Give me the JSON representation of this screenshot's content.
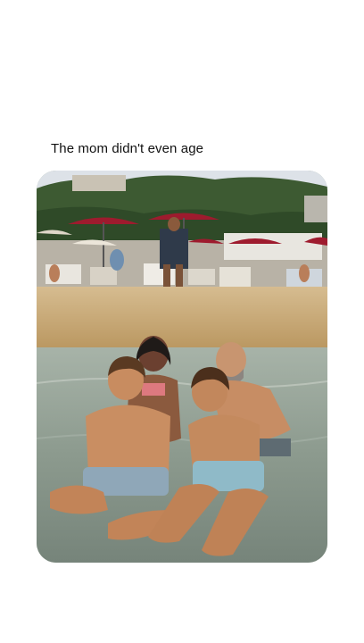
{
  "post": {
    "caption": "The mom didn't even age"
  },
  "photo": {
    "subject": "beach-group-photo",
    "colors": {
      "sky": "#d9dfe6",
      "hill": "#3f5a33",
      "umbrella": "#9e1b2e",
      "sand": "#c9ab7c",
      "water": "#8f9d92",
      "skin": "#c98e62"
    }
  }
}
